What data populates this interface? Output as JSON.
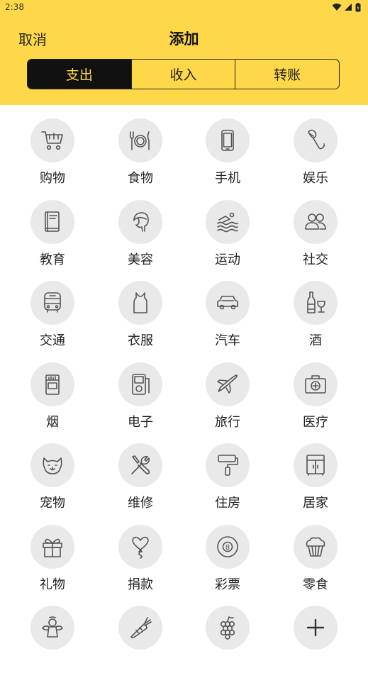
{
  "status_bar": {
    "time": "2:38"
  },
  "header": {
    "cancel_label": "取消",
    "title": "添加",
    "tabs": [
      {
        "label": "支出",
        "active": true
      },
      {
        "label": "收入",
        "active": false
      },
      {
        "label": "转账",
        "active": false
      }
    ]
  },
  "colors": {
    "accent": "#FFD84A",
    "active_tab_bg": "#111111",
    "icon_bg": "#E9E9E9"
  },
  "categories": [
    {
      "label": "购物",
      "icon": "shopping-cart-icon"
    },
    {
      "label": "食物",
      "icon": "fork-knife-plate-icon"
    },
    {
      "label": "手机",
      "icon": "phone-icon"
    },
    {
      "label": "娱乐",
      "icon": "microphone-icon"
    },
    {
      "label": "教育",
      "icon": "book-icon"
    },
    {
      "label": "美容",
      "icon": "hair-salon-icon"
    },
    {
      "label": "运动",
      "icon": "swimming-icon"
    },
    {
      "label": "社交",
      "icon": "people-icon"
    },
    {
      "label": "交通",
      "icon": "bus-icon"
    },
    {
      "label": "衣服",
      "icon": "tank-top-icon"
    },
    {
      "label": "汽车",
      "icon": "car-icon"
    },
    {
      "label": "酒",
      "icon": "wine-bottle-glass-icon"
    },
    {
      "label": "烟",
      "icon": "cigarette-pack-icon"
    },
    {
      "label": "电子",
      "icon": "music-player-icon"
    },
    {
      "label": "旅行",
      "icon": "airplane-icon"
    },
    {
      "label": "医疗",
      "icon": "first-aid-kit-icon"
    },
    {
      "label": "宠物",
      "icon": "pet-face-icon"
    },
    {
      "label": "维修",
      "icon": "wrench-screwdriver-icon"
    },
    {
      "label": "住房",
      "icon": "paint-roller-icon"
    },
    {
      "label": "居家",
      "icon": "cabinet-icon"
    },
    {
      "label": "礼物",
      "icon": "gift-icon"
    },
    {
      "label": "捐款",
      "icon": "heart-balloon-icon"
    },
    {
      "label": "彩票",
      "icon": "eight-ball-icon"
    },
    {
      "label": "零食",
      "icon": "cupcake-icon"
    },
    {
      "label": "",
      "icon": "angel-icon"
    },
    {
      "label": "",
      "icon": "carrot-icon"
    },
    {
      "label": "",
      "icon": "grapes-icon"
    },
    {
      "label": "",
      "icon": "add-icon"
    }
  ]
}
